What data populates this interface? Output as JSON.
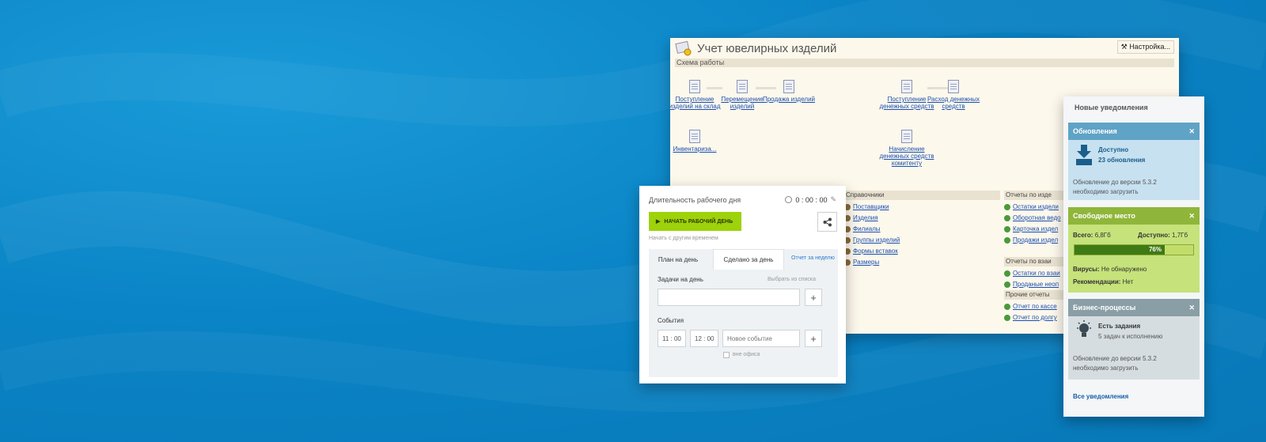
{
  "jewelry": {
    "title": "Учет ювелирных изделий",
    "settings": "Настройка...",
    "section": "Схема работы",
    "docs": {
      "receipt": "Поступление изделий на склад",
      "move": "Перемещение изделий",
      "sale": "Продажа изделий",
      "inventory": "Инвентариза...",
      "money_in": "Поступление денежных средств",
      "money_out": "Расход денежных средств",
      "accrual": "Начисление денежных средств комитенту"
    },
    "refs": {
      "header": "Справочники",
      "items": [
        "Поставщики",
        "Изделия",
        "Филиалы",
        "Группы изделий",
        "Формы вставок",
        "Размеры"
      ]
    },
    "reports": {
      "header": "Отчеты по изде",
      "items": [
        "Остатки издели",
        "Оборотная ведо",
        "Карточка издел",
        "Продажи издел"
      ],
      "header2": "Отчеты по взаи",
      "items2": [
        "Остатки по взаи",
        "Проданые неоп"
      ],
      "header3": "Прочие отчеты",
      "items3": [
        "Отчет по кассе",
        "Отчет по долгу"
      ]
    }
  },
  "workday": {
    "label": "Длительность рабочего дня",
    "timer": "0 : 00 : 00",
    "start_button": "НАЧАТЬ РАБОЧИЙ ДЕНЬ",
    "start_other": "Начать с другим временем",
    "tabs": [
      "План на день",
      "Сделано за день"
    ],
    "week_report": "Отчет за неделю",
    "tasks_label": "Задачи на день",
    "choose_list": "Выбрать из списка",
    "events_label": "События",
    "time_from": "11 : 00",
    "time_to": "12 : 00",
    "event_placeholder": "Новое событие",
    "out_office": "вне офиса"
  },
  "notifications": {
    "title": "Новые уведомления",
    "updates": {
      "header": "Обновления",
      "line1": "Доступно",
      "line2": "23 обновления",
      "desc1": "Обновление до версии 5.3.2",
      "desc2": "необходимо загрузить",
      "color": "#5fa3c6"
    },
    "space": {
      "header": "Свободное место",
      "total_label": "Всего:",
      "total_value": "6,8Гб",
      "avail_label": "Доступно:",
      "avail_value": "1,7Гб",
      "percent_text": "76%",
      "percent": 0.76,
      "virus_label": "Вирусы:",
      "virus_value": "Не обнаружено",
      "rec_label": "Рекомендации:",
      "rec_value": "Нет",
      "color": "#8fb63a"
    },
    "bp": {
      "header": "Бизнес-процессы",
      "line1": "Есть задания",
      "line2": "5 задач к исполнению",
      "desc1": "Обновление до версии 5.3.2",
      "desc2": "необходимо загрузить",
      "color": "#8a9ea6"
    },
    "all": "Все уведомления"
  }
}
